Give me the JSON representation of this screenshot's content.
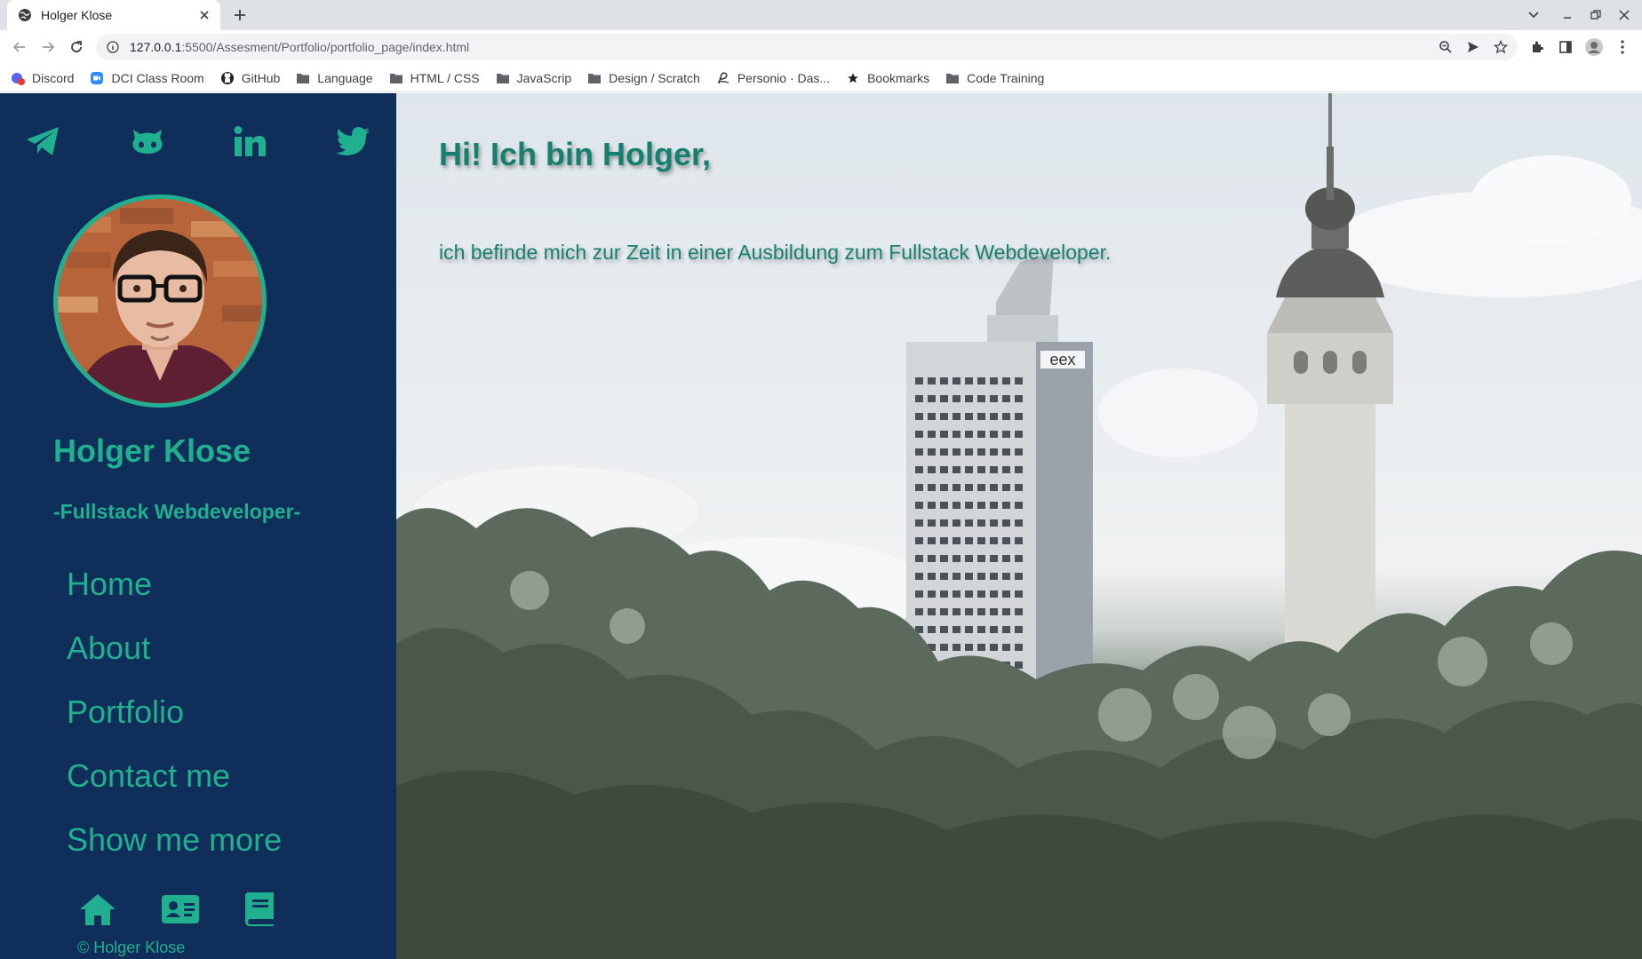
{
  "browser": {
    "tab_title": "Holger Klose",
    "url_host": "127.0.0.1",
    "url_rest": ":5500/Assesment/Portfolio/portfolio_page/index.html",
    "bookmarks": [
      {
        "label": "Discord",
        "icon": "discord-icon"
      },
      {
        "label": "DCI Class Room",
        "icon": "zoom-icon"
      },
      {
        "label": "GitHub",
        "icon": "github-icon"
      },
      {
        "label": "Language",
        "icon": "folder-icon"
      },
      {
        "label": "HTML / CSS",
        "icon": "folder-icon"
      },
      {
        "label": "JavaScrip",
        "icon": "folder-icon"
      },
      {
        "label": "Design / Scratch",
        "icon": "folder-icon"
      },
      {
        "label": "Personio · Das...",
        "icon": "personio-icon"
      },
      {
        "label": "Bookmarks",
        "icon": "star-icon"
      },
      {
        "label": "Code Training",
        "icon": "folder-icon"
      }
    ]
  },
  "sidebar": {
    "social": [
      "telegram-icon",
      "github-icon",
      "linkedin-icon",
      "twitter-icon"
    ],
    "name": "Holger Klose",
    "role": "-Fullstack Webdeveloper-",
    "nav": [
      "Home",
      "About",
      "Portfolio",
      "Contact me",
      "Show me more"
    ],
    "bottom_icons": [
      "home-icon",
      "contact-card-icon",
      "book-icon"
    ],
    "copyright": "© Holger Klose"
  },
  "hero": {
    "title": "Hi! Ich bin Holger,",
    "text": "ich befinde mich zur Zeit in einer Ausbildung zum Fullstack Webdeveloper."
  },
  "colors": {
    "sidebar_bg": "#0f2f5a",
    "accent": "#21b08f",
    "hero_text": "#167f6e"
  }
}
